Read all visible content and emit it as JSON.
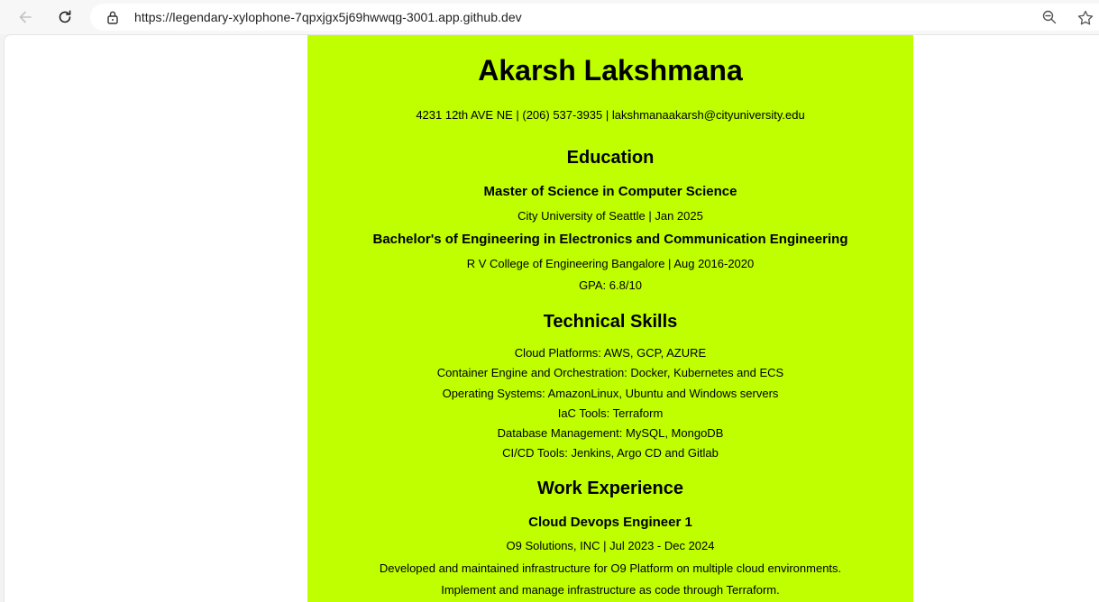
{
  "browser": {
    "url": "https://legendary-xylophone-7qpxjgx5j69hwwqg-3001.app.github.dev",
    "icons": [
      "back-arrow-icon",
      "reload-icon",
      "lock-icon",
      "zoom-out-icon",
      "star-icon"
    ]
  },
  "resume": {
    "name": "Akarsh Lakshmana",
    "contact": "4231 12th AVE NE | (206) 537-3935 | lakshmanaakarsh@cityuniversity.edu",
    "accent_color": "#bfff00",
    "education": {
      "heading": "Education",
      "degrees": [
        {
          "title": "Master of Science in Computer Science",
          "detail": "City University of Seattle | Jan 2025"
        },
        {
          "title": "Bachelor's of Engineering in Electronics and Communication Engineering",
          "detail": "R V College of Engineering Bangalore | Aug 2016-2020",
          "gpa": "GPA: 6.8/10"
        }
      ]
    },
    "skills": {
      "heading": "Technical Skills",
      "items": [
        "Cloud Platforms: AWS, GCP, AZURE",
        "Container Engine and Orchestration: Docker, Kubernetes and ECS",
        "Operating Systems: AmazonLinux, Ubuntu and Windows servers",
        "IaC Tools: Terraform",
        "Database Management: MySQL, MongoDB",
        "CI/CD Tools: Jenkins, Argo CD and Gitlab"
      ]
    },
    "experience": {
      "heading": "Work Experience",
      "jobs": [
        {
          "title": "Cloud Devops Engineer 1",
          "company": "O9 Solutions, INC | Jul 2023 - Dec 2024",
          "duties": [
            "Developed and maintained infrastructure for O9 Platform on multiple cloud environments.",
            "Implement and manage infrastructure as code through Terraform."
          ]
        }
      ]
    }
  }
}
